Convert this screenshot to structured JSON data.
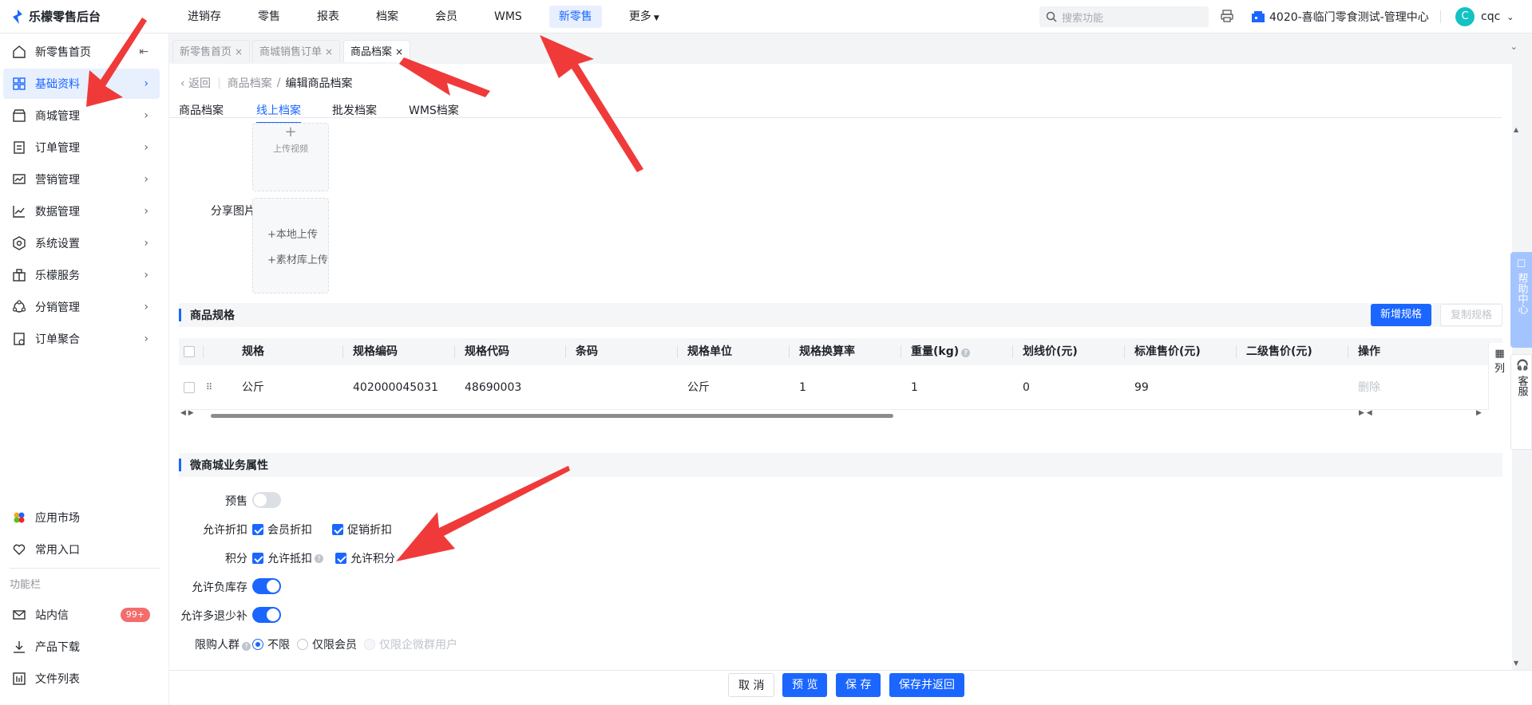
{
  "app": {
    "title": "乐檬零售后台"
  },
  "topnav": {
    "items": [
      "进销存",
      "零售",
      "报表",
      "档案",
      "会员",
      "WMS",
      "新零售",
      "更多"
    ]
  },
  "search": {
    "placeholder": "搜索功能"
  },
  "store": {
    "name": "4020-喜临门零食测试-管理中心"
  },
  "user": {
    "initial": "C",
    "name": "cqc"
  },
  "sidebar": {
    "items": [
      "新零售首页",
      "基础资料",
      "商城管理",
      "订单管理",
      "营销管理",
      "数据管理",
      "系统设置",
      "乐檬服务",
      "分销管理",
      "订单聚合"
    ],
    "bottom": [
      "应用市场",
      "常用入口"
    ],
    "section_label": "功能栏",
    "tools": [
      "站内信",
      "产品下载",
      "文件列表"
    ],
    "badge": "99+"
  },
  "tabs": [
    "新零售首页",
    "商城销售订单",
    "商品档案"
  ],
  "breadcrumb": {
    "back": "返回",
    "parent": "商品档案",
    "sep": "/",
    "current": "编辑商品档案"
  },
  "subtabs": [
    "商品档案",
    "线上档案",
    "批发档案",
    "WMS档案"
  ],
  "upload": {
    "video": "上传视频",
    "share_label": "分享图片",
    "local": "+本地上传",
    "library": "+素材库上传"
  },
  "spec": {
    "title": "商品规格",
    "add_btn": "新增规格",
    "copy_btn": "复制规格",
    "columns": [
      "规格",
      "规格编码",
      "规格代码",
      "条码",
      "规格单位",
      "规格换算率",
      "重量(kg)",
      "划线价(元)",
      "标准售价(元)",
      "二级售价(元)",
      "操作"
    ],
    "rows": [
      {
        "name": "公斤",
        "code": "402000045031",
        "pcode": "48690003",
        "barcode": "",
        "unit": "公斤",
        "rate": "1",
        "weight": "1",
        "list_price": "0",
        "price": "99",
        "price2": "",
        "action": "删除"
      }
    ],
    "col_cfg": "列"
  },
  "business": {
    "title": "微商城业务属性",
    "presale_label": "预售",
    "discount_label": "允许折扣",
    "discount_opts": [
      "会员折扣",
      "促销折扣"
    ],
    "points_label": "积分",
    "points_opts": [
      "允许抵扣",
      "允许积分"
    ],
    "neg_stock_label": "允许负库存",
    "refund_label": "允许多退少补",
    "limit_label": "限购人群",
    "limit_opts": [
      "不限",
      "仅限会员",
      "仅限企微群用户"
    ]
  },
  "footer": {
    "cancel": "取 消",
    "preview": "预 览",
    "save": "保 存",
    "save_return": "保存并返回"
  },
  "help_center": "帮助中心",
  "service": "客服",
  "colors": {
    "primary": "#1a66ff",
    "arrow": "#f03a3a",
    "badge": "#f56c6c"
  }
}
